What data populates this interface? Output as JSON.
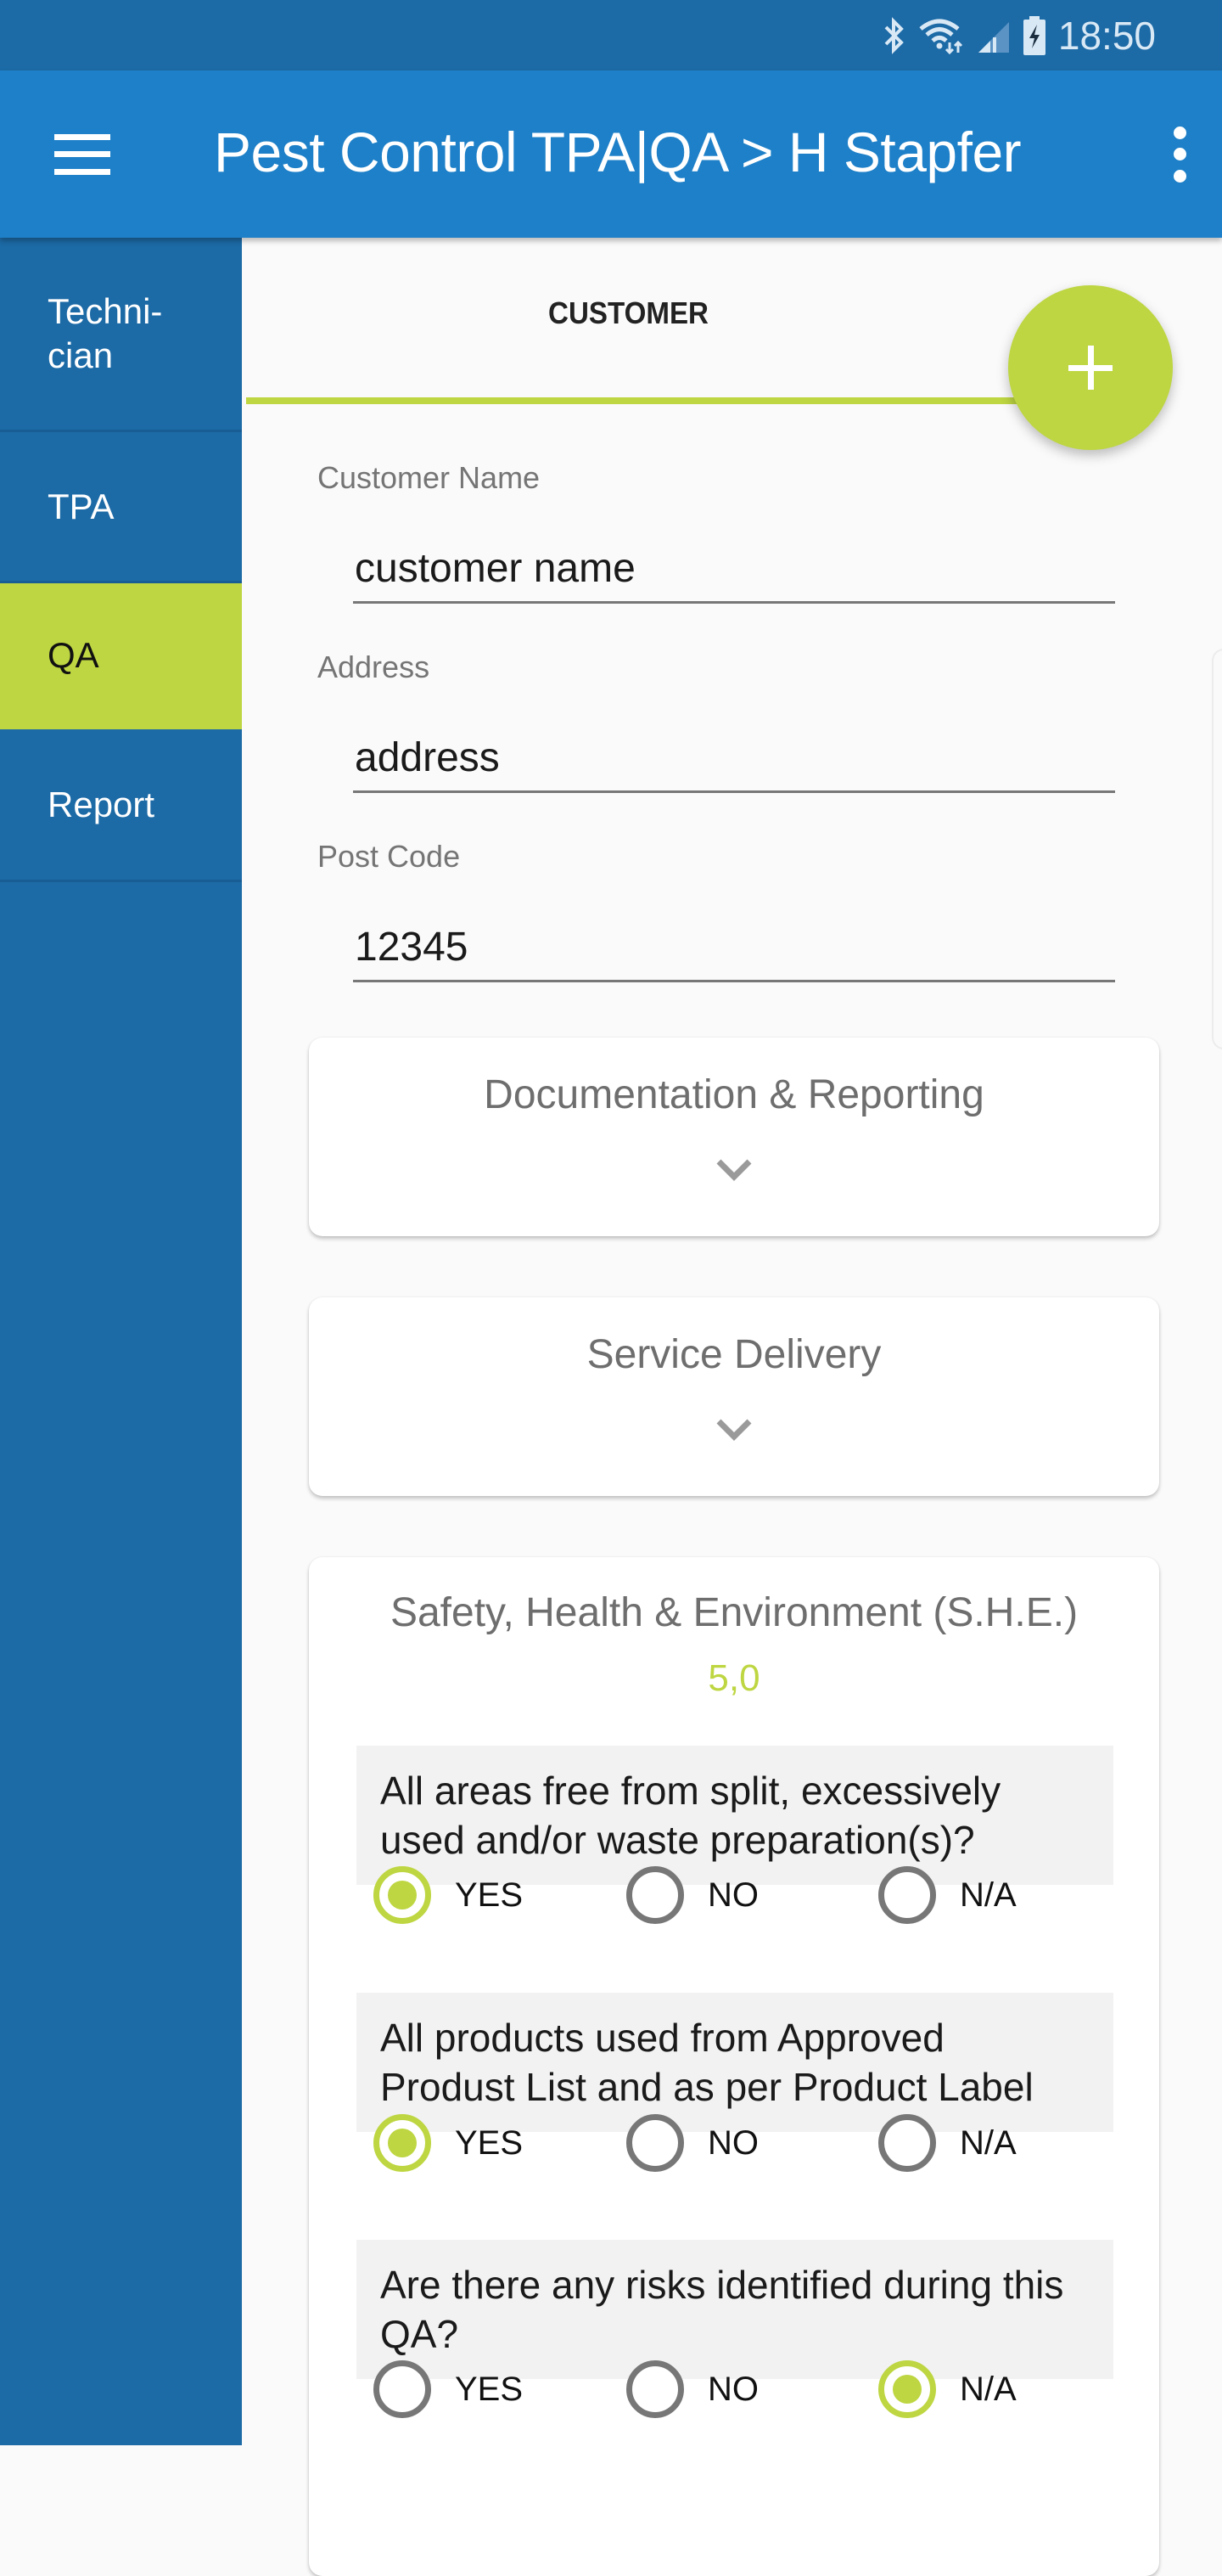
{
  "status_bar": {
    "time": "18:50",
    "icons": [
      "bluetooth-icon",
      "wifi-icon",
      "signal-icon",
      "battery-charging-icon"
    ]
  },
  "app_bar": {
    "menu_icon": "hamburger-menu-icon",
    "title": "Pest Control TPA|QA > H Stapfer",
    "overflow_icon": "more-vert-icon"
  },
  "sidebar": {
    "items": [
      {
        "label": "Techni-\ncian",
        "active": false
      },
      {
        "label": "TPA",
        "active": false
      },
      {
        "label": "QA",
        "active": true
      },
      {
        "label": "Report",
        "active": false
      }
    ]
  },
  "tabs": [
    {
      "label": "CUSTOMER",
      "active": true
    }
  ],
  "fab": {
    "icon": "plus-icon"
  },
  "form": {
    "customer_name": {
      "label": "Customer Name",
      "value": "customer name"
    },
    "address": {
      "label": "Address",
      "value": "address"
    },
    "post_code": {
      "label": "Post Code",
      "value": "12345"
    }
  },
  "sections": [
    {
      "title": "Documentation & Reporting",
      "expanded": false
    },
    {
      "title": "Service Delivery",
      "expanded": false
    },
    {
      "title": "Safety, Health & Environment (S.H.E.)",
      "expanded": true,
      "score": "5,0",
      "questions": [
        {
          "text": "All areas free from split, excessively used and/or waste preparation(s)?",
          "options": [
            "YES",
            "NO",
            "N/A"
          ],
          "selected": "YES"
        },
        {
          "text": "All products used from Approved Produst List and as per Product Label",
          "options": [
            "YES",
            "NO",
            "N/A"
          ],
          "selected": "YES"
        },
        {
          "text": "Are there any risks identified during this QA?",
          "options": [
            "YES",
            "NO",
            "N/A"
          ],
          "selected": "N/A"
        }
      ]
    }
  ],
  "colors": {
    "primary": "#1e80c8",
    "primary_dark": "#1c6aa6",
    "accent": "#bed641",
    "background": "#fafafa"
  }
}
